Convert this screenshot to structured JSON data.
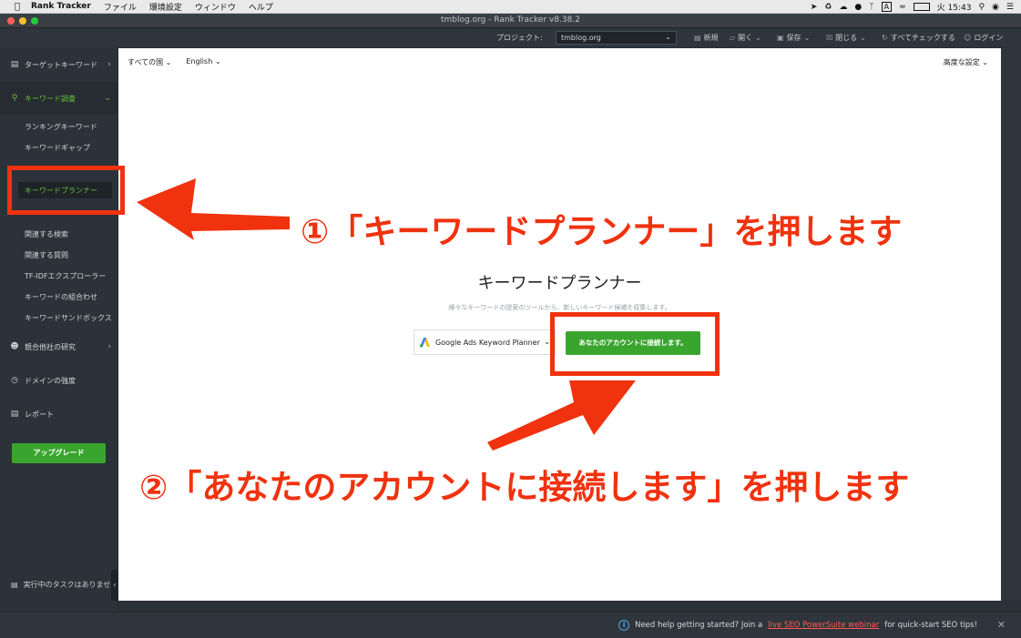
{
  "menubar": {
    "app_name": "Rank Tracker",
    "items": [
      "ファイル",
      "環境設定",
      "ウィンドウ",
      "ヘルプ"
    ],
    "clock": "火 15:43"
  },
  "window": {
    "title": "tmblog.org - Rank Tracker v8.38.2"
  },
  "toolbar": {
    "project_label": "プロジェクト:",
    "project_value": "tmblog.org",
    "new": "新規",
    "open": "開く",
    "save": "保存",
    "close": "閉じる",
    "check_all": "すべてチェックする",
    "login": "ログイン"
  },
  "sidebar": {
    "target_keywords": "ターゲットキーワード",
    "keyword_research": "キーワード調査",
    "sub_items": {
      "ranking": "ランキングキーワード",
      "gap": "キーワードギャップ",
      "planner": "キーワードプランナー",
      "related_search": "関連する検索",
      "related_questions": "関連する質問",
      "tfidf": "TF-IDFエクスプローラー",
      "combination": "キーワードの組合わせ",
      "sandbox": "キーワードサンドボックス"
    },
    "competitor": "競合他社の研究",
    "domain_strength": "ドメインの強度",
    "report": "レポート",
    "upgrade": "アップグレード",
    "tasks": "実行中のタスクはありません"
  },
  "main": {
    "country": "すべての国",
    "language": "English",
    "advanced": "高度な設定",
    "planner_title": "キーワードプランナー",
    "planner_subtitle": "様々なキーワードの提案のツールから、新しいキーワード候補を収集します。",
    "source": "Google Ads Keyword Planner",
    "connect_button": "あなたのアカウントに接続します。"
  },
  "bottombar": {
    "help_prefix": "Need help getting started? Join a",
    "help_link": "live SEO PowerSuite webinar",
    "help_suffix": "for quick-start SEO tips!"
  },
  "annotations": {
    "step1": "①「キーワードプランナー」を押します",
    "step2": "②「あなたのアカウントに接続します」を押します"
  },
  "colors": {
    "accent_green": "#3aa52e",
    "sidebar_active": "#69c23b",
    "annotation_red": "#f0320f",
    "help_link": "#ff5a4f"
  }
}
